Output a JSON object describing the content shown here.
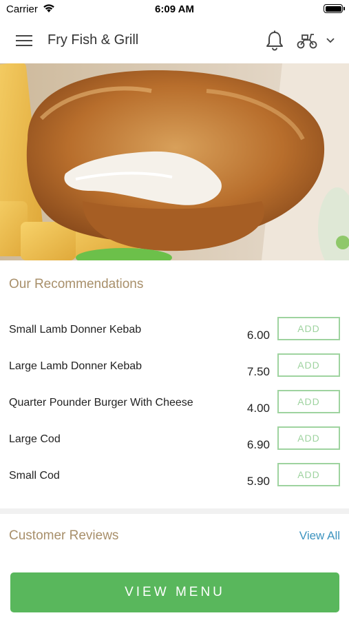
{
  "status_bar": {
    "carrier": "Carrier",
    "time": "6:09 AM"
  },
  "header": {
    "title": "Fry Fish & Grill",
    "icons": [
      "menu-icon",
      "bell-icon",
      "scooter-icon",
      "chevron-down-icon"
    ]
  },
  "hero": {
    "image": "fried-fish-and-chips-photo"
  },
  "recommendations": {
    "heading": "Our Recommendations",
    "add_label": "ADD",
    "items": [
      {
        "name": "Small Lamb Donner Kebab",
        "price": "6.00"
      },
      {
        "name": "Large Lamb Donner Kebab",
        "price": "7.50"
      },
      {
        "name": "Quarter Pounder Burger With Cheese",
        "price": "4.00"
      },
      {
        "name": "Large Cod",
        "price": "6.90"
      },
      {
        "name": "Small Cod",
        "price": "5.90"
      }
    ]
  },
  "reviews": {
    "heading": "Customer Reviews",
    "view_all": "View All"
  },
  "footer": {
    "view_menu": "VIEW MENU"
  },
  "colors": {
    "accent_green": "#59b75c",
    "add_border": "#9ed39f",
    "heading_tan": "#a88f6a",
    "link_blue": "#3c93bf"
  }
}
